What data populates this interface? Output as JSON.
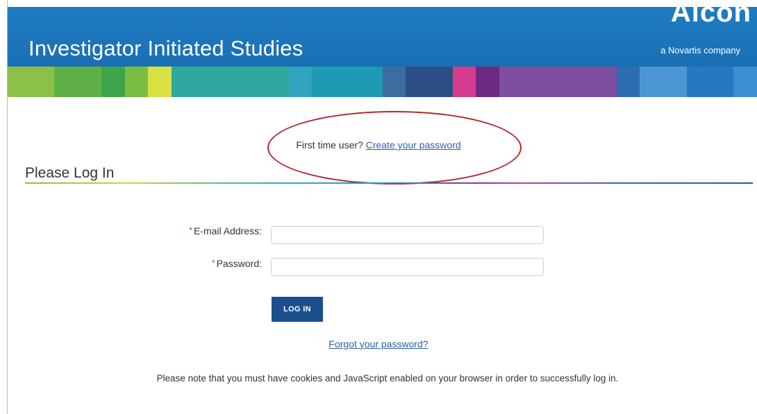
{
  "header": {
    "title": "Investigator Initiated Studies",
    "brand": "Alcon",
    "tagline": "a Novartis company"
  },
  "stripe_colors": [
    "#8dc048",
    "#8dc048",
    "#5fb147",
    "#5fb147",
    "#3ea54a",
    "#7bbd44",
    "#d9e043",
    "#2fa8a0",
    "#2fa8a0",
    "#2fa8a0",
    "#2fa8a0",
    "#2fa8a0",
    "#30a4be",
    "#1f9ab4",
    "#1f9ab4",
    "#1f9ab4",
    "#3b6da0",
    "#2a4e85",
    "#2a4e85",
    "#d53b8e",
    "#6e2a83",
    "#7e4ea0",
    "#7e4ea0",
    "#7e4ea0",
    "#7e4ea0",
    "#7e4ea0",
    "#2c6db2",
    "#4b95d2",
    "#4b95d2",
    "#2779bf",
    "#2779bf",
    "#3b8fd0"
  ],
  "invite": {
    "prompt": "First time user?",
    "link": "Create your password"
  },
  "section": {
    "title": "Please Log In"
  },
  "form": {
    "email_label": "E-mail Address:",
    "password_label": "Password:",
    "required_marker": "*",
    "email_value": "",
    "password_value": "",
    "login_button": "LOG IN"
  },
  "forgot_link": "Forgot your password?",
  "note": "Please note that you must have cookies and JavaScript enabled on your browser in order to successfully log in."
}
